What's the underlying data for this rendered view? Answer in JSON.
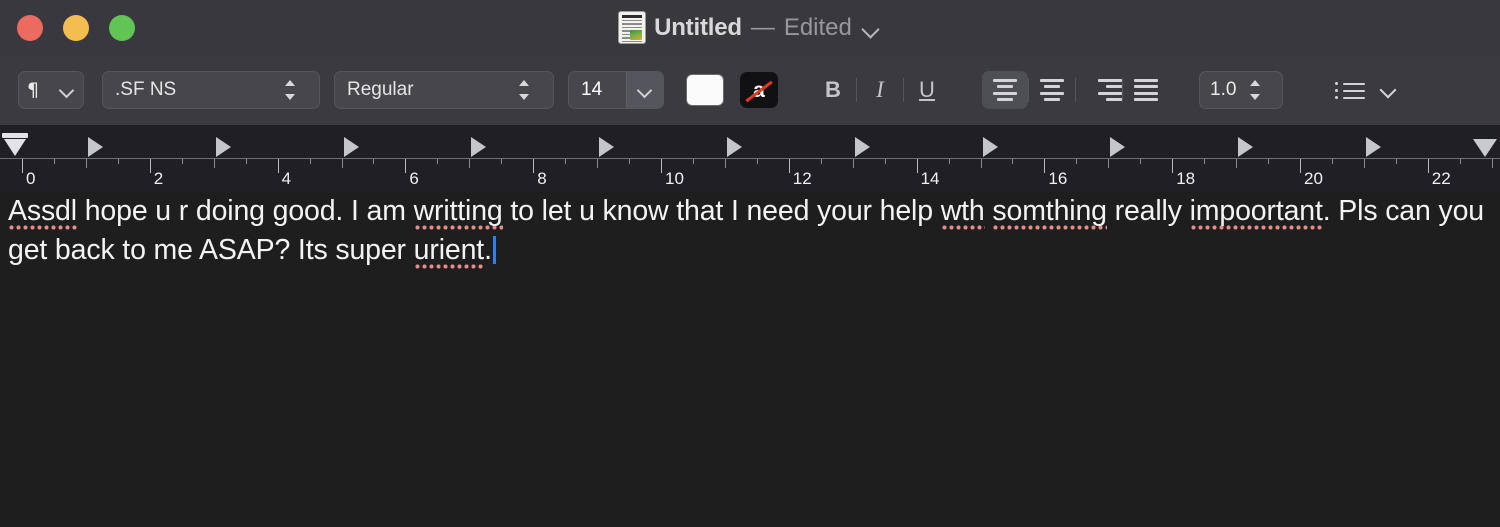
{
  "window": {
    "traffic_lights": [
      {
        "name": "close",
        "color": "#ec6a5f"
      },
      {
        "name": "minimize",
        "color": "#f4bd4f"
      },
      {
        "name": "maximize",
        "color": "#61c555"
      }
    ],
    "title": "Untitled",
    "title_separator": "—",
    "title_status": "Edited",
    "doc_icon": "document-icon",
    "title_chevron_icon": "chevron-down-icon"
  },
  "toolbar": {
    "paragraph_style": {
      "icon": "pilcrow-icon",
      "glyph": "¶",
      "chevron": "chevron-down-icon"
    },
    "font_family": {
      "value": ".SF NS",
      "stepper": "stepper-arrows-icon"
    },
    "font_style": {
      "value": "Regular",
      "stepper": "stepper-arrows-icon"
    },
    "font_size": {
      "value": "14",
      "chevron": "chevron-down-icon"
    },
    "color_swatch": {
      "name": "text-background-color-swatch",
      "color": "#fbfbfb"
    },
    "text_color_button": {
      "name": "text-color-button",
      "glyph": "a",
      "slash_color": "#e03b22",
      "background": "#111114"
    },
    "bold": {
      "label": "B",
      "name": "bold-button"
    },
    "italic": {
      "label": "I",
      "name": "italic-button"
    },
    "underline": {
      "label": "U",
      "name": "underline-button"
    },
    "align": [
      {
        "name": "align-left-button",
        "active": true
      },
      {
        "name": "align-center-button",
        "active": false
      },
      {
        "name": "align-right-button",
        "active": false
      },
      {
        "name": "align-justify-button",
        "active": false
      }
    ],
    "line_spacing": {
      "value": "1.0",
      "stepper": "stepper-arrows-icon"
    },
    "lists": {
      "icon": "bullet-list-icon",
      "chevron": "chevron-down-icon"
    }
  },
  "ruler": {
    "numbers": [
      "0",
      "2",
      "4",
      "6",
      "8",
      "10",
      "12",
      "14",
      "16",
      "18",
      "20",
      "22"
    ],
    "left_indent_marker": "left-indent-marker",
    "right_indent_marker": "right-indent-marker",
    "tab_marker": "tab-stop-marker"
  },
  "document": {
    "segments": [
      {
        "text": "Assdl",
        "misspelled": true
      },
      {
        "text": " hope u r doing good. I am ",
        "misspelled": false
      },
      {
        "text": "writting",
        "misspelled": true
      },
      {
        "text": " to let u know that I need your help ",
        "misspelled": false
      },
      {
        "text": "wth",
        "misspelled": true
      },
      {
        "text": " ",
        "misspelled": false
      },
      {
        "text": "somthing",
        "misspelled": true
      },
      {
        "text": " really ",
        "misspelled": false
      },
      {
        "text": "impoortant",
        "misspelled": true
      },
      {
        "text": ". Pls can you get back to me ASAP? Its super ",
        "misspelled": false
      },
      {
        "text": "urient",
        "misspelled": true
      },
      {
        "text": ".",
        "misspelled": false
      }
    ],
    "full_text": "Assdl hope u r doing good. I am writting to let u know that I need your help wth somthing really impoortant. Pls can you get back to me ASAP? Its super urient.",
    "caret": "text-cursor"
  }
}
